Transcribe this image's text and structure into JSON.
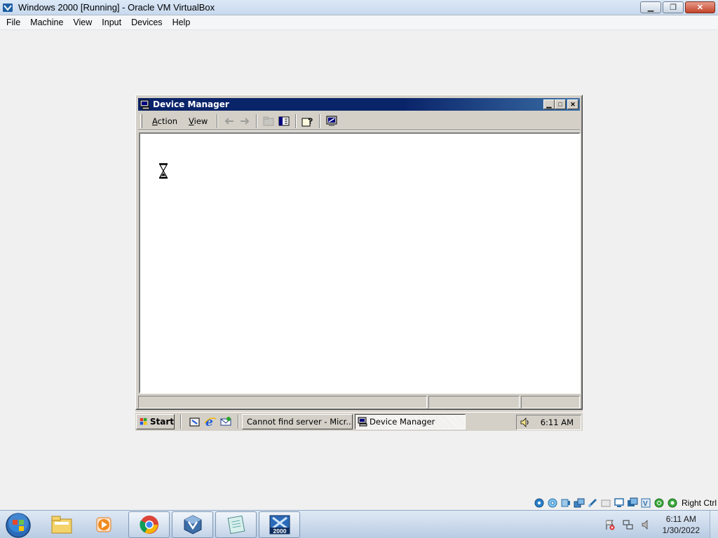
{
  "host_window": {
    "title": "Windows 2000 [Running] - Oracle VM VirtualBox",
    "app_icon": "virtualbox-icon",
    "controls": {
      "minimize": "minimize-icon",
      "restore": "restore-icon",
      "close": "close-icon"
    }
  },
  "host_menu": [
    "File",
    "Machine",
    "View",
    "Input",
    "Devices",
    "Help"
  ],
  "guest": {
    "device_manager": {
      "title": "Device Manager",
      "toolbar": {
        "menus": [
          {
            "label_underlined": "A",
            "label_rest": "ction"
          },
          {
            "label_underlined": "V",
            "label_rest": "iew"
          }
        ],
        "buttons": [
          "back-arrow-icon",
          "forward-arrow-icon",
          "up-folder-icon",
          "show-hide-tree-icon",
          "help-icon",
          "scan-hardware-icon"
        ]
      },
      "cursor": "hourglass-icon"
    },
    "taskbar": {
      "start_label": "Start",
      "quick_launch": [
        "show-desktop-icon",
        "internet-explorer-icon",
        "outlook-express-icon"
      ],
      "tasks": [
        {
          "label": "Cannot find server - Micr...",
          "icon": "internet-explorer-icon",
          "active": false
        },
        {
          "label": "Device Manager",
          "icon": "device-manager-icon",
          "active": true
        }
      ],
      "tray_icon": "volume-icon",
      "clock": "6:11 AM"
    }
  },
  "vbox_status": {
    "icons": [
      "hard-disk-icon",
      "optical-drive-icon",
      "audio-icon",
      "network-icon",
      "usb-icon",
      "shared-folder-icon",
      "display-icon",
      "video-capture-icon",
      "cpu-icon",
      "mouse-integration-icon",
      "keyboard-icon"
    ],
    "host_key": "Right Ctrl"
  },
  "host_taskbar": {
    "pinned": [
      "windows-start-orb",
      "file-explorer-icon",
      "media-player-icon",
      "chrome-icon",
      "virtualbox-icon",
      "notepad-icon",
      "windows-2000-vm-icon"
    ],
    "vm_badge": "2000",
    "tray": [
      "action-center-flag-icon",
      "network-icon",
      "volume-icon"
    ],
    "time": "6:11 AM",
    "date": "1/30/2022"
  },
  "colors": {
    "w2k_face": "#d4d0c8",
    "w2k_title_active": "#0a246a",
    "w7_taskbar": "#b9cce3"
  }
}
